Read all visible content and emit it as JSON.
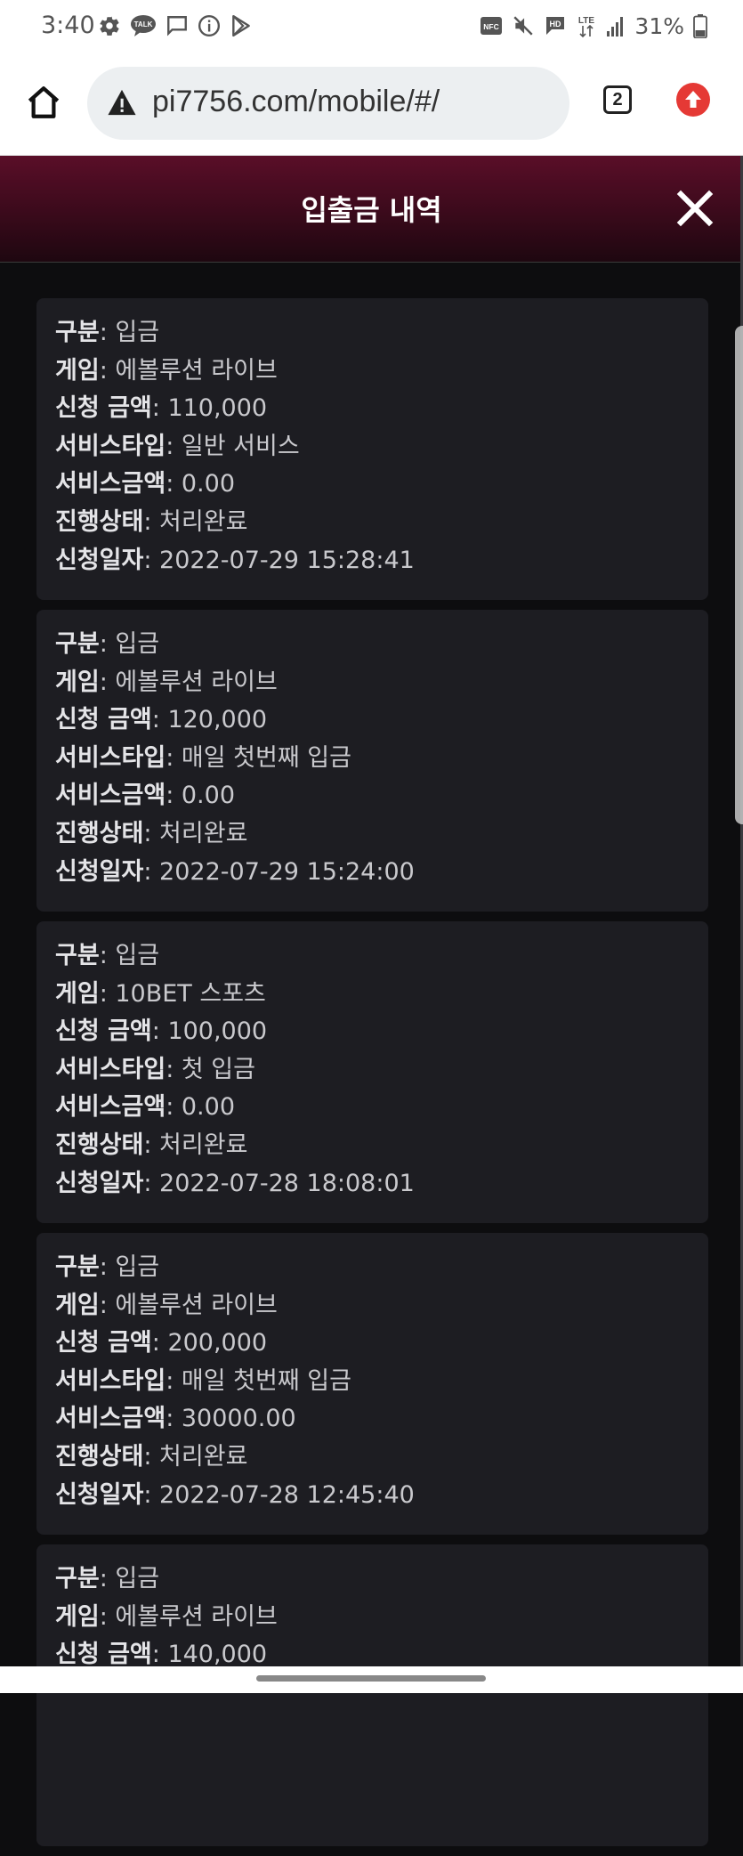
{
  "status_bar": {
    "time": "3:40",
    "battery": "31%",
    "left_icons": [
      "gear-icon",
      "talk-icon",
      "message-icon",
      "info-icon",
      "play-store-icon"
    ],
    "right_icons": [
      "nfc-icon",
      "mute-icon",
      "hd-icon",
      "lte-icon",
      "signal-icon",
      "battery-icon"
    ],
    "talk_label": "TALK",
    "nfc_label": "NFC",
    "hd_label": "HD",
    "lte_label": "LTE"
  },
  "browser": {
    "url": "pi7756.com/mobile/#/",
    "tab_count": "2"
  },
  "modal": {
    "title": "입출금 내역"
  },
  "records": [
    {
      "fields": [
        {
          "key": "구분",
          "value": ": 입금"
        },
        {
          "key": "게임",
          "value": ": 에볼루션 라이브"
        },
        {
          "key": "신청 금액",
          "value": ": 110,000"
        },
        {
          "key": "서비스타입",
          "value": ": 일반 서비스"
        },
        {
          "key": "서비스금액",
          "value": ": 0.00"
        },
        {
          "key": "진행상태",
          "value": ": 처리완료"
        },
        {
          "key": "신청일자",
          "value": ": 2022-07-29 15:28:41"
        }
      ]
    },
    {
      "fields": [
        {
          "key": "구분",
          "value": ": 입금"
        },
        {
          "key": "게임",
          "value": ": 에볼루션 라이브"
        },
        {
          "key": "신청 금액",
          "value": ": 120,000"
        },
        {
          "key": "서비스타입",
          "value": ": 매일 첫번째 입금"
        },
        {
          "key": "서비스금액",
          "value": ": 0.00"
        },
        {
          "key": "진행상태",
          "value": ": 처리완료"
        },
        {
          "key": "신청일자",
          "value": ": 2022-07-29 15:24:00"
        }
      ]
    },
    {
      "fields": [
        {
          "key": "구분",
          "value": ": 입금"
        },
        {
          "key": "게임",
          "value": ": 10BET 스포츠"
        },
        {
          "key": "신청 금액",
          "value": ": 100,000"
        },
        {
          "key": "서비스타입",
          "value": ": 첫 입금"
        },
        {
          "key": "서비스금액",
          "value": ": 0.00"
        },
        {
          "key": "진행상태",
          "value": ": 처리완료"
        },
        {
          "key": "신청일자",
          "value": ": 2022-07-28 18:08:01"
        }
      ]
    },
    {
      "fields": [
        {
          "key": "구분",
          "value": ": 입금"
        },
        {
          "key": "게임",
          "value": ": 에볼루션 라이브"
        },
        {
          "key": "신청 금액",
          "value": ": 200,000"
        },
        {
          "key": "서비스타입",
          "value": ": 매일 첫번째 입금"
        },
        {
          "key": "서비스금액",
          "value": ": 30000.00"
        },
        {
          "key": "진행상태",
          "value": ": 처리완료"
        },
        {
          "key": "신청일자",
          "value": ": 2022-07-28 12:45:40"
        }
      ]
    },
    {
      "fields": [
        {
          "key": "구분",
          "value": ": 입금"
        },
        {
          "key": "게임",
          "value": ": 에볼루션 라이브"
        },
        {
          "key": "신청 금액",
          "value": ": 140,000"
        }
      ]
    }
  ]
}
